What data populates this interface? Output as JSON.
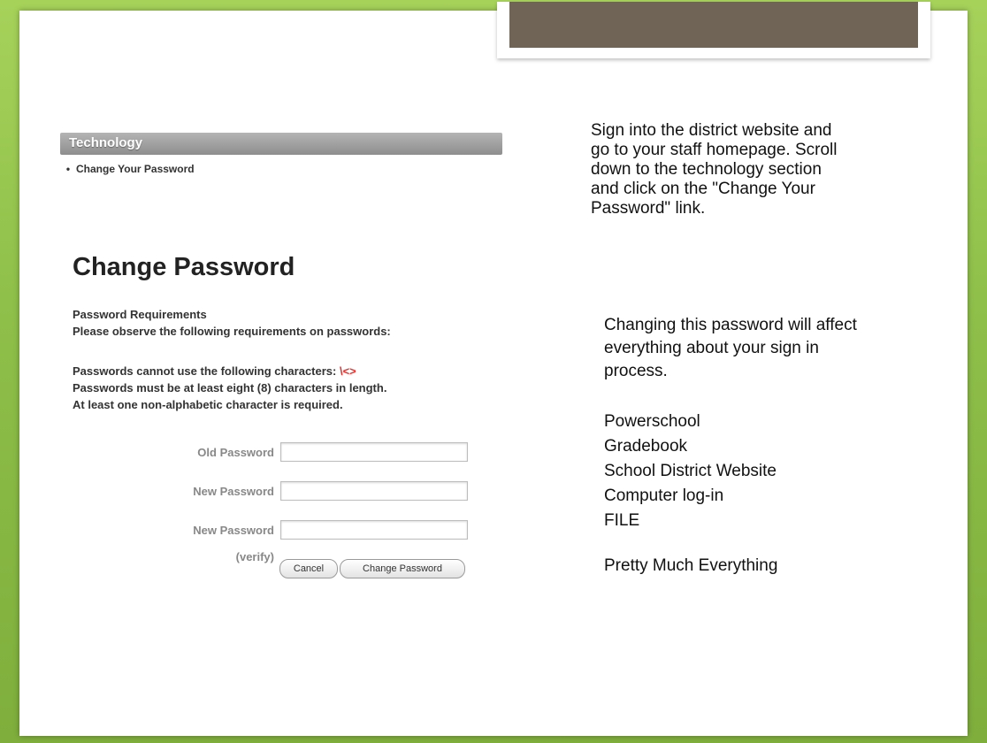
{
  "technology": {
    "header": "Technology",
    "link": "Change Your Password",
    "bullet": "•"
  },
  "change_password": {
    "title": "Change Password",
    "requirements_heading": "Password Requirements",
    "requirements_intro": "Please observe the following requirements on passwords:",
    "rule_chars_text": "Passwords cannot use the following characters: ",
    "rule_chars_value": "\\<>",
    "rule_length": "Passwords must be at least eight (8) characters in length.",
    "rule_nonalpha": "At least one non-alphabetic character is required.",
    "fields": {
      "old_label": "Old Password",
      "new_label": "New Password",
      "verify_label": "New Password",
      "verify_sub": "(verify)",
      "old_value": "",
      "new_value": "",
      "verify_value": ""
    },
    "cancel_label": "Cancel",
    "submit_label": "Change Password"
  },
  "notes": {
    "instruction": [
      "Sign into the district website and",
      "go to your staff homepage.  Scroll",
      "down to the technology section",
      "and click on the \"Change Your",
      "Password\" link."
    ],
    "effect": [
      "Changing this password will affect",
      "everything about your sign in",
      "process."
    ],
    "systems": [
      "Powerschool",
      "Gradebook",
      "School District Website",
      "Computer log-in",
      "FILE"
    ],
    "summary": "Pretty Much Everything"
  },
  "colors": {
    "frame_green": "#8fc04a",
    "tab_brown": "#6f6455",
    "forbidden_chars": "#e8302c"
  }
}
